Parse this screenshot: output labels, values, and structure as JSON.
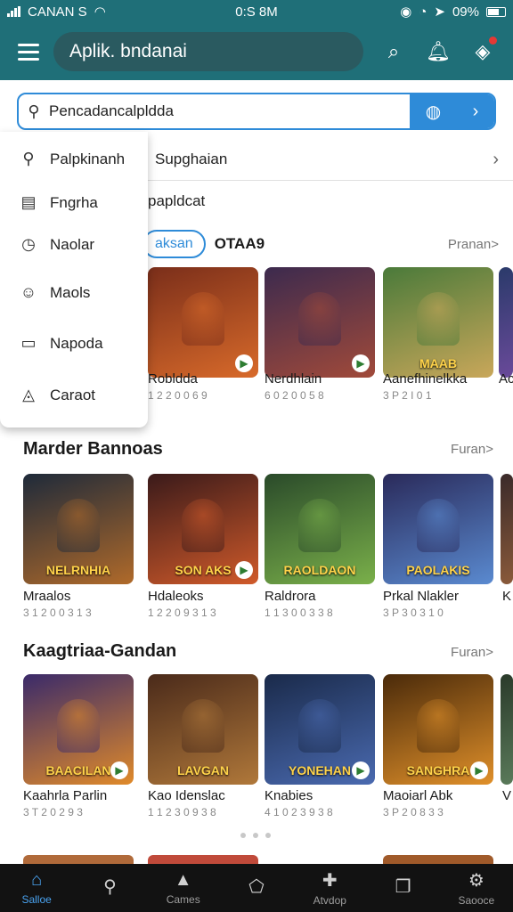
{
  "status_bar": {
    "carrier": "CANAN S",
    "time": "0:S 8M",
    "battery": "09%"
  },
  "app_bar": {
    "title": "Aplik. bndanai"
  },
  "search": {
    "placeholder": "Pencadancalpldda"
  },
  "menu": {
    "items": [
      {
        "label": "Palpkinanh",
        "icon": "search-icon"
      },
      {
        "label": "Fngrha",
        "icon": "document-icon"
      },
      {
        "label": "Naolar",
        "icon": "clock-icon"
      },
      {
        "label": "Maols",
        "icon": "face-icon"
      },
      {
        "label": "Napoda",
        "icon": "inbox-icon"
      },
      {
        "label": "Caraot",
        "icon": "navigation-icon"
      }
    ]
  },
  "suggestion_row": {
    "label": "Supghaian"
  },
  "subheading": "papldcat",
  "chips_row": {
    "chip": "aksan",
    "text": "OTAA9",
    "more": "Pranan>"
  },
  "sections": [
    {
      "title": "",
      "more": "",
      "tiles": [
        {
          "name": "Robldda",
          "sub": "1 2 2 0 0 6 9",
          "caption": "",
          "colors": [
            "#7a2e1a",
            "#d86a2a"
          ]
        },
        {
          "name": "Nerdhlain",
          "sub": "6 0 2 0 0 5 8",
          "caption": "",
          "colors": [
            "#3c2a4e",
            "#a14a3a"
          ]
        },
        {
          "name": "Aanefhinelkka",
          "sub": "3 P 2 I 0 1",
          "caption": "MAAB",
          "colors": [
            "#4a7a3a",
            "#c9a75a"
          ]
        },
        {
          "name": "Ac",
          "sub": "",
          "caption": "",
          "colors": [
            "#2a3a6a",
            "#6a4a9a"
          ]
        }
      ]
    },
    {
      "title": "Marder Bannoas",
      "more": "Furan>",
      "tiles": [
        {
          "name": "Mraalos",
          "sub": "3 1 2 0 0 3 1 3",
          "caption": "NELRNHIA",
          "colors": [
            "#1e2a3a",
            "#b06a2a"
          ]
        },
        {
          "name": "Hdaleoks",
          "sub": "1 2 2 0 9 3 1 3",
          "caption": "SON AKS",
          "colors": [
            "#3a1a1a",
            "#d05a2a"
          ]
        },
        {
          "name": "Raldrora",
          "sub": "1 1 3 0 0 3 3 8",
          "caption": "RAOLDAON",
          "colors": [
            "#2a4a2a",
            "#7ab04a"
          ]
        },
        {
          "name": "Prkal Nlakler",
          "sub": "3 P 3 0 3 1 0",
          "caption": "PAOLAKIS",
          "colors": [
            "#2a2a5a",
            "#5a8ad0"
          ]
        },
        {
          "name": "K",
          "sub": "",
          "caption": "",
          "colors": [
            "#3a2a2a",
            "#8a5a3a"
          ]
        }
      ]
    },
    {
      "title": "Kaagtriaa-Gandan",
      "more": "Furan>",
      "tiles": [
        {
          "name": "Kaahrla Parlin",
          "sub": "3 T 2 0 2 9 3",
          "caption": "BAACILAN",
          "colors": [
            "#3a2a6a",
            "#e08a2a"
          ]
        },
        {
          "name": "Kao Idenslac",
          "sub": "1 1 2 3 0 9 3 8",
          "caption": "LAVGAN",
          "colors": [
            "#4a2a1a",
            "#b0783a"
          ]
        },
        {
          "name": "Knabies",
          "sub": "4 1 0 2 3 9 3 8",
          "caption": "YONEHAN",
          "colors": [
            "#1a2a4a",
            "#4a6ab0"
          ]
        },
        {
          "name": "Maoiarl Abk",
          "sub": "3 P 2 0 8 3 3",
          "caption": "SANGHRA",
          "colors": [
            "#4a2a0a",
            "#e0902a"
          ]
        },
        {
          "name": "V",
          "sub": "",
          "caption": "",
          "colors": [
            "#2a3a2a",
            "#5a7a5a"
          ]
        }
      ]
    }
  ],
  "bottom_nav": [
    {
      "label": "Salloe",
      "icon": "home-icon",
      "active": true
    },
    {
      "label": "",
      "icon": "search-icon",
      "active": false
    },
    {
      "label": "Cames",
      "icon": "games-icon",
      "active": false
    },
    {
      "label": "",
      "icon": "apps-icon",
      "active": false
    },
    {
      "label": "Atvdop",
      "icon": "add-icon",
      "active": false
    },
    {
      "label": "",
      "icon": "book-icon",
      "active": false
    },
    {
      "label": "Saooce",
      "icon": "settings-icon",
      "active": false
    }
  ],
  "colors": {
    "primary": "#1f6f78",
    "accent": "#2e8bd8",
    "nav_bg": "#121212"
  }
}
